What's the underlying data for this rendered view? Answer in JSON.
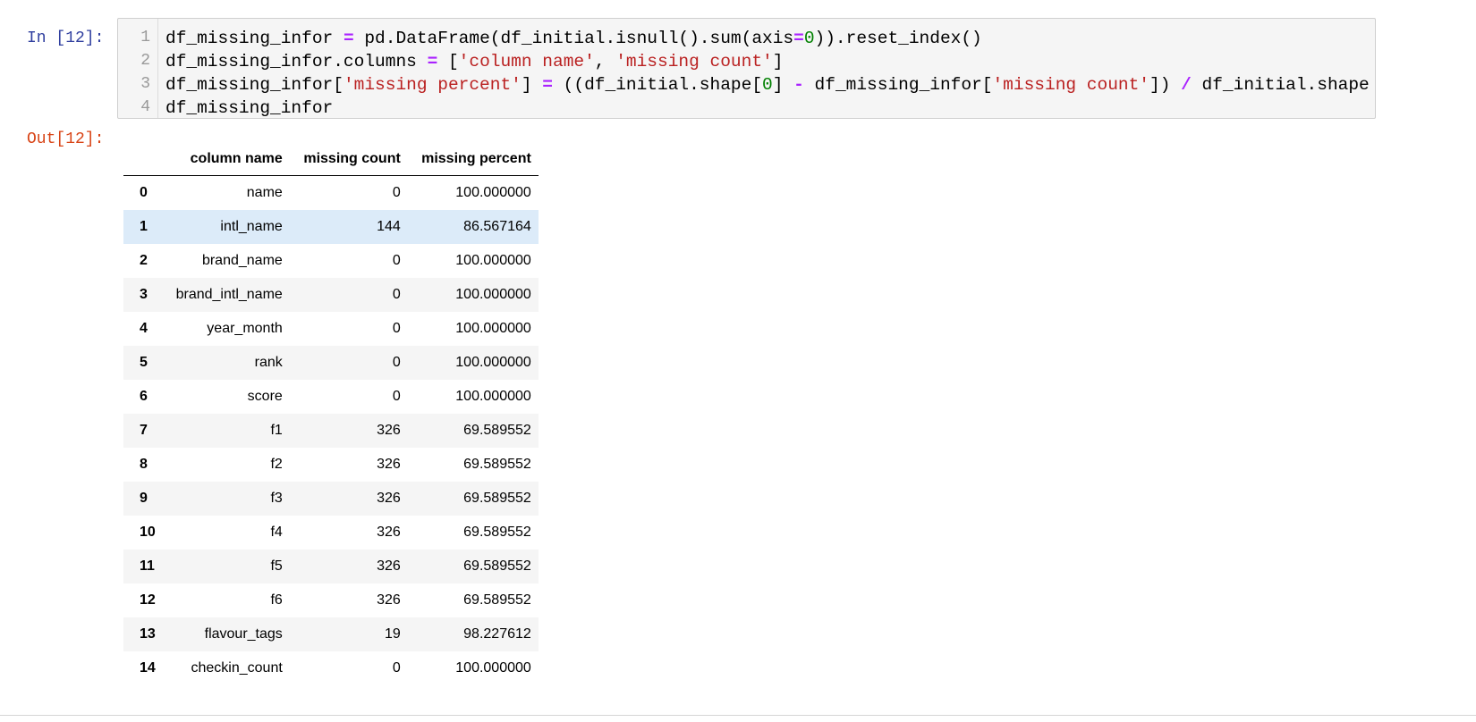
{
  "input_prompt": "In [12]:",
  "output_prompt": "Out[12]:",
  "code_lines": [
    [
      [
        "df_missing_infor ",
        ""
      ],
      [
        "=",
        "op"
      ],
      [
        " pd.DataFrame(df_initial.isnull().sum(axis",
        ""
      ],
      [
        "=",
        "op"
      ],
      [
        "0",
        "num"
      ],
      [
        ")).reset_index()",
        ""
      ]
    ],
    [
      [
        "df_missing_infor.columns ",
        ""
      ],
      [
        "=",
        "op"
      ],
      [
        " [",
        ""
      ],
      [
        "'column name'",
        "str"
      ],
      [
        ", ",
        ""
      ],
      [
        "'missing count'",
        "str"
      ],
      [
        "]",
        ""
      ]
    ],
    [
      [
        "df_missing_infor[",
        ""
      ],
      [
        "'missing percent'",
        "str"
      ],
      [
        "] ",
        ""
      ],
      [
        "=",
        "op"
      ],
      [
        " ((df_initial.shape[",
        ""
      ],
      [
        "0",
        "num"
      ],
      [
        "] ",
        ""
      ],
      [
        "-",
        "op"
      ],
      [
        " df_missing_infor[",
        ""
      ],
      [
        "'missing count'",
        "str"
      ],
      [
        "]) ",
        ""
      ],
      [
        "/",
        "op"
      ],
      [
        " df_initial.shape",
        ""
      ]
    ],
    [
      [
        "df_missing_infor",
        ""
      ]
    ]
  ],
  "line_numbers": [
    "1",
    "2",
    "3",
    "4"
  ],
  "table": {
    "columns": [
      "column name",
      "missing count",
      "missing percent"
    ],
    "rows": [
      [
        "0",
        "name",
        "0",
        "100.000000"
      ],
      [
        "1",
        "intl_name",
        "144",
        "86.567164"
      ],
      [
        "2",
        "brand_name",
        "0",
        "100.000000"
      ],
      [
        "3",
        "brand_intl_name",
        "0",
        "100.000000"
      ],
      [
        "4",
        "year_month",
        "0",
        "100.000000"
      ],
      [
        "5",
        "rank",
        "0",
        "100.000000"
      ],
      [
        "6",
        "score",
        "0",
        "100.000000"
      ],
      [
        "7",
        "f1",
        "326",
        "69.589552"
      ],
      [
        "8",
        "f2",
        "326",
        "69.589552"
      ],
      [
        "9",
        "f3",
        "326",
        "69.589552"
      ],
      [
        "10",
        "f4",
        "326",
        "69.589552"
      ],
      [
        "11",
        "f5",
        "326",
        "69.589552"
      ],
      [
        "12",
        "f6",
        "326",
        "69.589552"
      ],
      [
        "13",
        "flavour_tags",
        "19",
        "98.227612"
      ],
      [
        "14",
        "checkin_count",
        "0",
        "100.000000"
      ]
    ],
    "hover_row": 1
  }
}
